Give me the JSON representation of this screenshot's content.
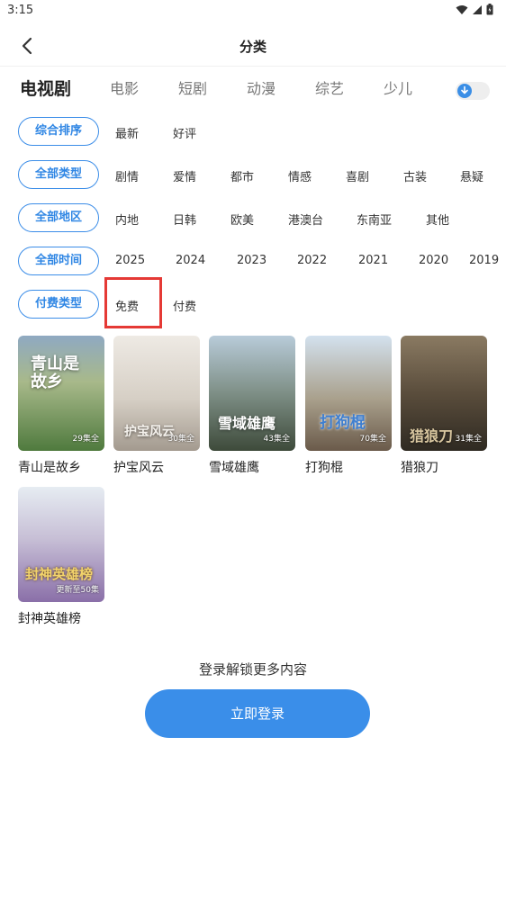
{
  "status": {
    "time": "3:15"
  },
  "header": {
    "title": "分类"
  },
  "categories": {
    "active": "电视剧",
    "items": [
      "电影",
      "短剧",
      "动漫",
      "综艺",
      "少儿"
    ]
  },
  "filters": {
    "sort": {
      "label": "综合排序",
      "options": [
        "最新",
        "好评"
      ]
    },
    "genre": {
      "label": "全部类型",
      "options": [
        "剧情",
        "爱情",
        "都市",
        "情感",
        "喜剧",
        "古装",
        "悬疑"
      ]
    },
    "region": {
      "label": "全部地区",
      "options": [
        "内地",
        "日韩",
        "欧美",
        "港澳台",
        "东南亚",
        "其他"
      ]
    },
    "year": {
      "label": "全部时间",
      "options": [
        "2025",
        "2024",
        "2023",
        "2022",
        "2021",
        "2020",
        "2019"
      ]
    },
    "fee": {
      "label": "付费类型",
      "options": [
        "免费",
        "付费"
      ]
    }
  },
  "posters": [
    {
      "title": "青山是故乡",
      "episodes": "29集全",
      "poster_text": "青山是故乡",
      "colors": [
        "#8fa9c2",
        "#4f7a3e"
      ]
    },
    {
      "title": "护宝风云",
      "episodes": "30集全",
      "poster_text": "护宝风云",
      "colors": [
        "#e6e1da",
        "#a39a8f"
      ]
    },
    {
      "title": "雪域雄鹰",
      "episodes": "43集全",
      "poster_text": "雪域雄鹰",
      "colors": [
        "#9fb7c9",
        "#4a5a45"
      ]
    },
    {
      "title": "打狗棍",
      "episodes": "70集全",
      "poster_text": "打狗棍",
      "colors": [
        "#c9d9e8",
        "#6a5a4a"
      ]
    },
    {
      "title": "猎狼刀",
      "episodes": "31集全",
      "poster_text": "猎狼刀",
      "colors": [
        "#7a6a55",
        "#2f2a22"
      ]
    },
    {
      "title": "封神英雄榜",
      "episodes": "更新至50集",
      "poster_text": "封神英雄榜",
      "colors": [
        "#dfe6ee",
        "#8a6fa8"
      ]
    }
  ],
  "login": {
    "hint": "登录解锁更多内容",
    "button": "立即登录"
  },
  "accent": "#3a8ee9",
  "highlight": "#e53935"
}
